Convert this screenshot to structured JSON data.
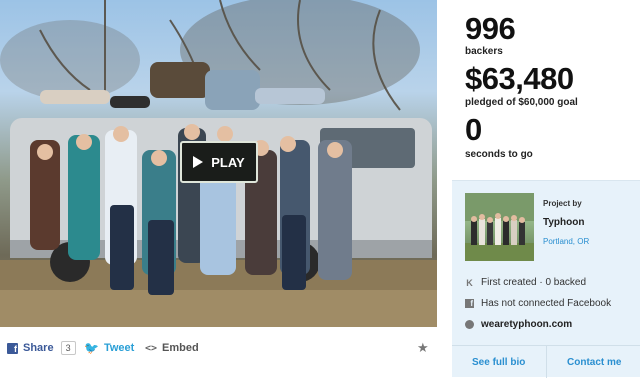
{
  "video": {
    "play_label": "PLAY"
  },
  "share_bar": {
    "facebook_label": "Share",
    "facebook_count": "3",
    "tweet_label": "Tweet",
    "embed_label": "Embed",
    "embed_icon_glyph": "<>"
  },
  "stats": {
    "backers_count": "996",
    "backers_label": "backers",
    "pledged_amount": "$63,480",
    "pledged_label": "pledged of $60,000 goal",
    "time_value": "0",
    "time_label": "seconds to go"
  },
  "creator": {
    "project_by_label": "Project by",
    "name": "Typhoon",
    "location": "Portland, OR",
    "created_text": "First created · 0 backed",
    "facebook_text": "Has not connected Facebook",
    "website": "wearetyphoon.com",
    "bio_link": "See full bio",
    "contact_link": "Contact me"
  },
  "colors": {
    "link_blue": "#2a8fd0",
    "facebook_blue": "#3b5998",
    "twitter_blue": "#2a9fd6",
    "card_bg": "#e7f2fa"
  },
  "icons": {
    "facebook": "facebook-icon",
    "twitter": "twitter-bird-icon",
    "embed": "code-brackets-icon",
    "star": "star-icon",
    "kickstarter": "kickstarter-k-icon",
    "globe": "globe-icon"
  }
}
